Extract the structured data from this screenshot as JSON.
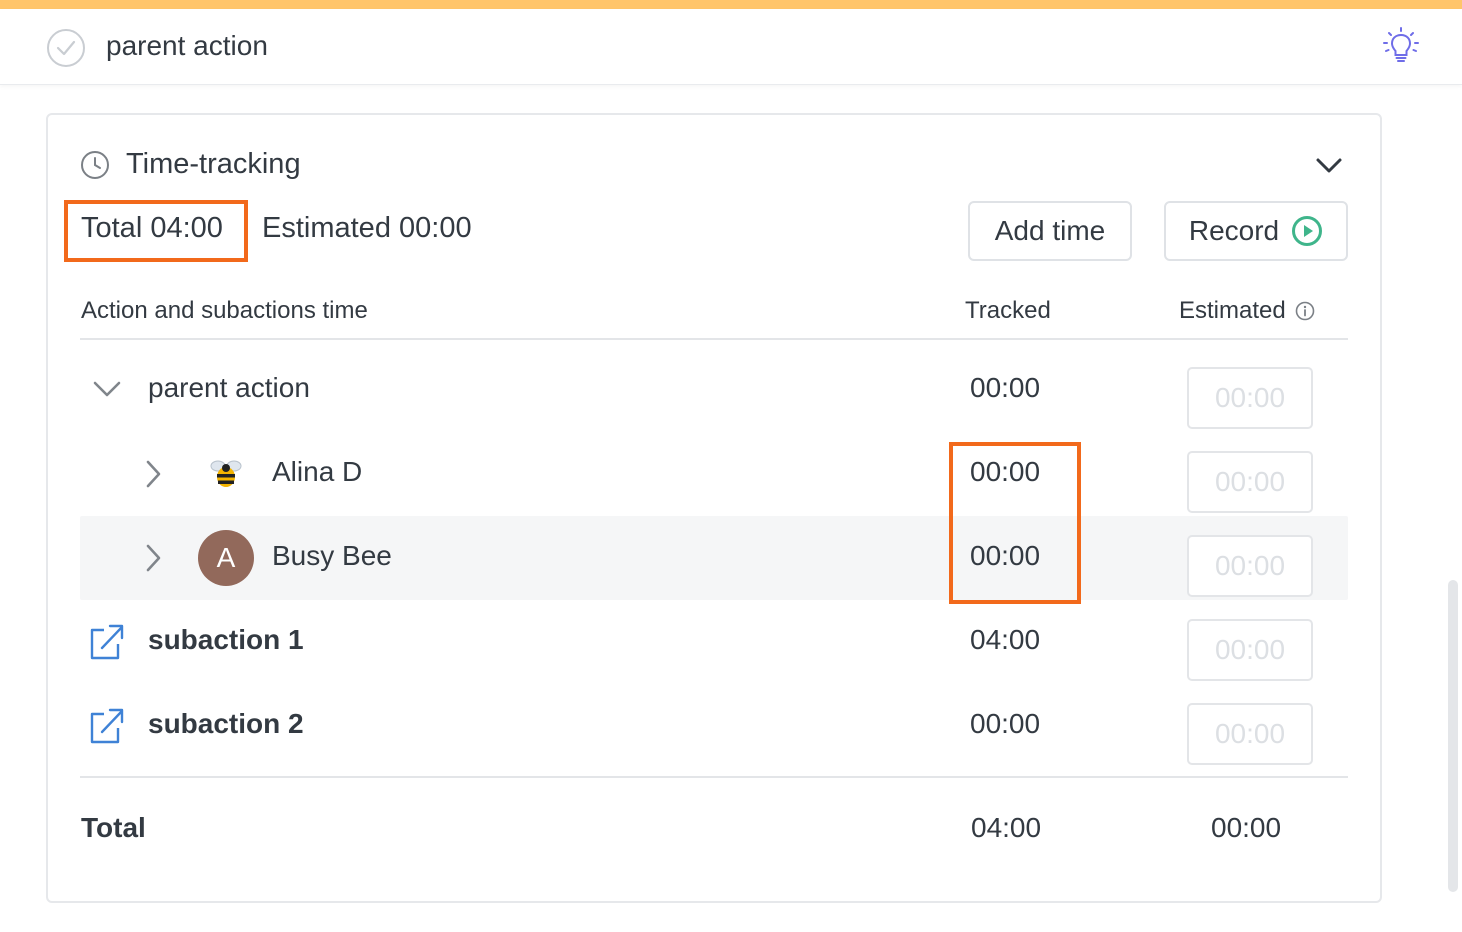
{
  "header": {
    "title": "parent action"
  },
  "time_tracking": {
    "title": "Time-tracking",
    "total_label": "Total 04:00",
    "estimated_label": "Estimated 00:00",
    "add_time_label": "Add time",
    "record_label": "Record",
    "columns": {
      "name": "Action and subactions time",
      "tracked": "Tracked",
      "estimated": "Estimated"
    },
    "rows": [
      {
        "name": "parent action",
        "tracked": "00:00",
        "estimated": "00:00"
      },
      {
        "name": "Alina D",
        "tracked": "00:00",
        "estimated": "00:00"
      },
      {
        "name": "Busy Bee",
        "avatar_letter": "A",
        "tracked": "00:00",
        "estimated": "00:00"
      },
      {
        "name": "subaction 1",
        "tracked": "04:00",
        "estimated": "00:00"
      },
      {
        "name": "subaction 2",
        "tracked": "00:00",
        "estimated": "00:00"
      }
    ],
    "footer": {
      "label": "Total",
      "tracked": "04:00",
      "estimated": "00:00"
    }
  },
  "colors": {
    "accent_bar": "#ffc56b",
    "highlight_outline": "#f2691b",
    "record_green": "#3fb58b",
    "link_blue": "#3f82d6",
    "avatar_brown": "#92695b",
    "bulb_purple": "#6f6de8"
  },
  "icons": [
    "check-circle-icon",
    "lightbulb-icon",
    "clock-icon",
    "chevron-down-icon",
    "play-icon",
    "info-icon",
    "chevron-right-icon",
    "bee-avatar-icon",
    "external-link-icon"
  ]
}
